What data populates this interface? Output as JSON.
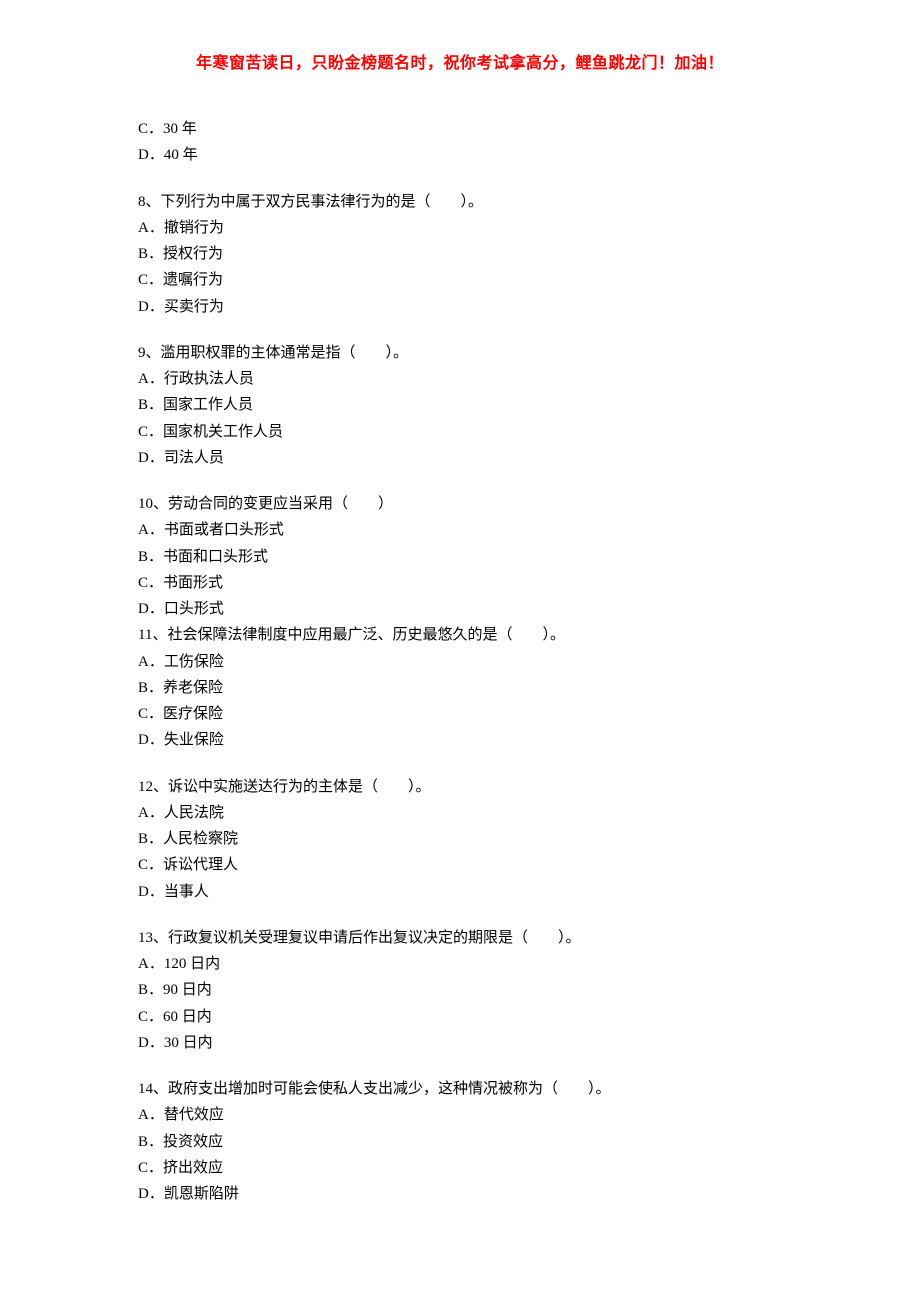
{
  "header": "年寒窗苦读日，只盼金榜题名时，祝你考试拿高分，鲤鱼跳龙门！加油！",
  "q7": {
    "optC": "C．30 年",
    "optD": "D．40 年"
  },
  "q8": {
    "stem": "8、下列行为中属于双方民事法律行为的是（　　）。",
    "optA": "A．撤销行为",
    "optB": "B．授权行为",
    "optC": "C．遗嘱行为",
    "optD": "D．买卖行为"
  },
  "q9": {
    "stem": "9、滥用职权罪的主体通常是指（　　）。",
    "optA": "A．行政执法人员",
    "optB": "B．国家工作人员",
    "optC": "C．国家机关工作人员",
    "optD": "D．司法人员"
  },
  "q10": {
    "stem": "10、劳动合同的变更应当采用（　　）",
    "optA": "A．书面或者口头形式",
    "optB": "B．书面和口头形式",
    "optC": "C．书面形式",
    "optD": "D．口头形式"
  },
  "q11": {
    "stem": "11、社会保障法律制度中应用最广泛、历史最悠久的是（　　）。",
    "optA": "A．工伤保险",
    "optB": "B．养老保险",
    "optC": "C．医疗保险",
    "optD": "D．失业保险"
  },
  "q12": {
    "stem": "12、诉讼中实施送达行为的主体是（　　）。",
    "optA": "A．人民法院",
    "optB": "B．人民检察院",
    "optC": "C．诉讼代理人",
    "optD": "D．当事人"
  },
  "q13": {
    "stem": "13、行政复议机关受理复议申请后作出复议决定的期限是（　　）。",
    "optA": "A．120 日内",
    "optB": "B．90 日内",
    "optC": "C．60 日内",
    "optD": "D．30 日内"
  },
  "q14": {
    "stem": "14、政府支出增加时可能会使私人支出减少，这种情况被称为（　　）。",
    "optA": "A．替代效应",
    "optB": "B．投资效应",
    "optC": "C．挤出效应",
    "optD": "D．凯恩斯陷阱"
  }
}
